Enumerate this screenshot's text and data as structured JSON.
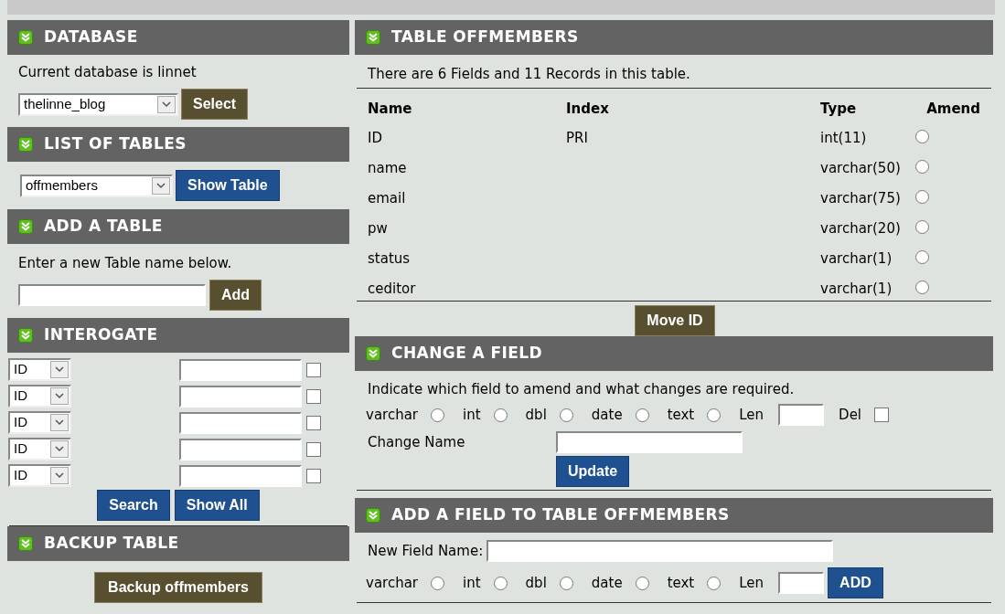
{
  "database": {
    "title": "DATABASE",
    "text": "Current database is linnet",
    "select_value": "thelinne_blog",
    "button": "Select"
  },
  "list_of_tables": {
    "title": "LIST OF TABLES",
    "select_value": "offmembers",
    "button": "Show Table"
  },
  "add_table": {
    "title": "ADD A TABLE",
    "text": "Enter a new Table name below.",
    "button": "Add"
  },
  "interogate": {
    "title": "INTEROGATE",
    "rows": [
      {
        "field": "ID",
        "checked": false
      },
      {
        "field": "ID",
        "checked": false
      },
      {
        "field": "ID",
        "checked": false
      },
      {
        "field": "ID",
        "checked": false
      },
      {
        "field": "ID",
        "checked": false
      }
    ],
    "buttons": [
      "Search",
      "Show All"
    ]
  },
  "backup_table": {
    "title": "BACKUP TABLE",
    "button": "Backup offmembers"
  },
  "table_panel": {
    "title": "TABLE OFFMEMBERS",
    "summary": "There are 6 Fields and 11 Records in this table.",
    "columns": [
      "Name",
      "Index",
      "Type",
      "Amend"
    ],
    "rows": [
      {
        "name": "ID",
        "index": "PRI",
        "type": "int(11)",
        "selected": false
      },
      {
        "name": "name",
        "index": "",
        "type": "varchar(50)",
        "selected": false
      },
      {
        "name": "email",
        "index": "",
        "type": "varchar(75)",
        "selected": false
      },
      {
        "name": "pw",
        "index": "",
        "type": "varchar(20)",
        "selected": false
      },
      {
        "name": "status",
        "index": "",
        "type": "varchar(1)",
        "selected": false
      },
      {
        "name": "ceditor",
        "index": "",
        "type": "varchar(1)",
        "selected": false
      }
    ],
    "button": "Move ID"
  },
  "change_field": {
    "title": "CHANGE A FIELD",
    "text": "Indicate which field to amend and what changes are required.",
    "types": [
      {
        "label": "varchar",
        "selected": false
      },
      {
        "label": "int",
        "selected": false
      },
      {
        "label": "dbl",
        "selected": false
      },
      {
        "label": "date",
        "selected": false
      },
      {
        "label": "text",
        "selected": false
      }
    ],
    "len_label": "Len",
    "del_label": "Del",
    "del_checked": false,
    "change_name_label": "Change Name",
    "button": "Update"
  },
  "add_field": {
    "title": "ADD A FIELD TO TABLE OFFMEMBERS",
    "name_label": "New Field Name:",
    "types": [
      {
        "label": "varchar",
        "selected": false
      },
      {
        "label": "int",
        "selected": false
      },
      {
        "label": "dbl",
        "selected": false
      },
      {
        "label": "date",
        "selected": false
      },
      {
        "label": "text",
        "selected": false
      }
    ],
    "len_label": "Len",
    "button": "ADD"
  }
}
